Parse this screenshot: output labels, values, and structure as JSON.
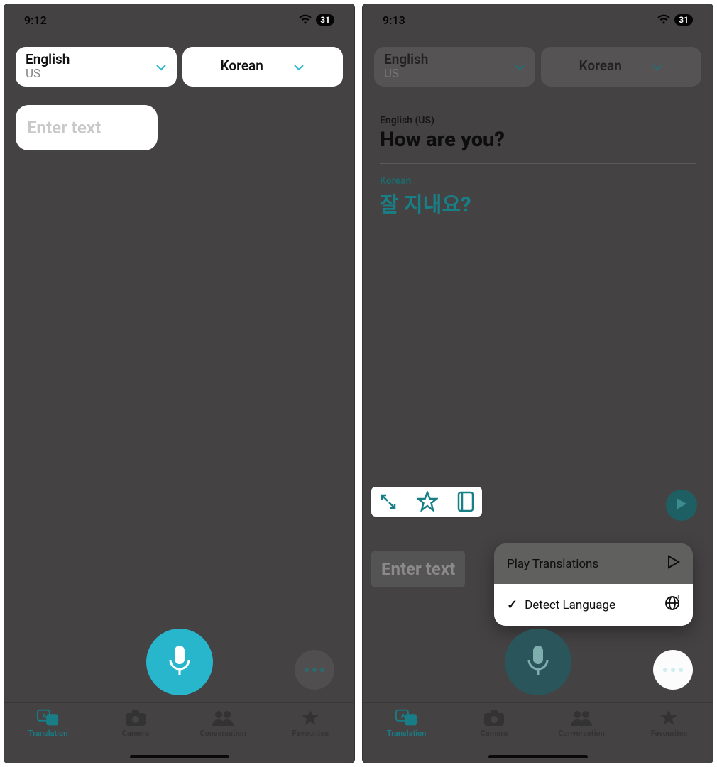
{
  "colors": {
    "accent": "#28b6cc",
    "accentDim": "#187d87"
  },
  "screen1": {
    "status": {
      "time": "9:12",
      "battery": "31"
    },
    "langs": {
      "source": {
        "name": "English",
        "region": "US"
      },
      "target": {
        "name": "Korean"
      }
    },
    "input": {
      "placeholder": "Enter text"
    },
    "tabs": {
      "translation": "Translation",
      "camera": "Camera",
      "conversation": "Conversation",
      "favourites": "Favourites"
    }
  },
  "screen2": {
    "status": {
      "time": "9:13",
      "battery": "31"
    },
    "langs": {
      "source": {
        "name": "English",
        "region": "US"
      },
      "target": {
        "name": "Korean"
      }
    },
    "result": {
      "sourceLabel": "English (US)",
      "sourceText": "How are you?",
      "targetLabel": "Korean",
      "targetText": "잘 지내요?"
    },
    "actions": {
      "expand": "expand-icon",
      "star": "star-icon",
      "book": "book-icon",
      "play": "play-icon"
    },
    "input": {
      "placeholder": "Enter text"
    },
    "popup": {
      "item1": "Play Translations",
      "item2": "Detect Language"
    },
    "tabs": {
      "translation": "Translation",
      "camera": "Camera",
      "conversation": "Conversation",
      "favourites": "Favourites"
    }
  }
}
